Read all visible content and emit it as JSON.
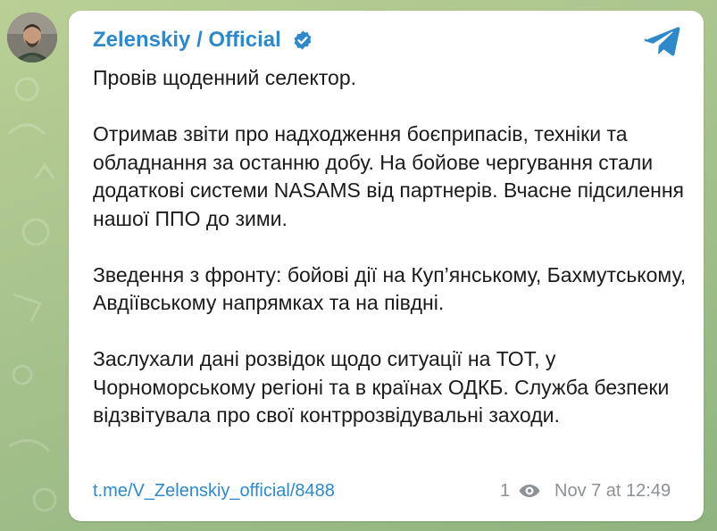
{
  "channel": {
    "title": "Zelenskiy / Official",
    "verified_icon": "verified-badge-icon",
    "app_icon": "telegram-icon",
    "avatar": "channel-avatar"
  },
  "message": {
    "paragraphs": [
      "Провів щоденний селектор.",
      "Отримав звіти про надходження боєприпасів, техніки та обладнання за останню добу. На бойове чергування стали додаткові системи NASAMS від партнерів. Вчасне підсилення нашої ППО до зими.",
      "Зведення з фронту: бойові дії на Куп’янському, Бахмутському, Авдіївському напрямках та на півдні.",
      "Заслухали дані розвідок щодо ситуації на ТОТ, у Чорноморському регіоні та в країнах ОДКБ. Служба безпеки відзвітувала про свої контррозвідувальні заходи."
    ],
    "link": "t.me/V_Zelenskiy_official/8488",
    "views": "1",
    "views_icon": "eye-icon",
    "timestamp": "Nov 7 at 12:49"
  },
  "colors": {
    "accent": "#2f88c8",
    "background": "#a9c38f",
    "bubble": "#ffffff",
    "meta_text": "#8b9197"
  }
}
